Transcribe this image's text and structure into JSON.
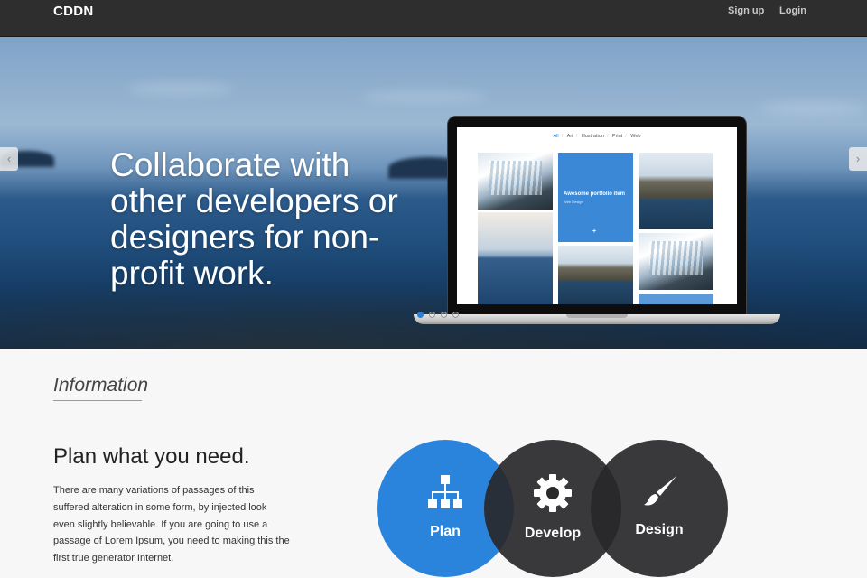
{
  "navbar": {
    "brand": "CDDN",
    "links": {
      "signup": "Sign up",
      "login": "Login"
    }
  },
  "hero": {
    "headline": "Collaborate with other developers or designers for non-profit work.",
    "arrows": {
      "prev": "‹",
      "next": "›"
    },
    "slides": {
      "count": 4,
      "active_index": 0
    }
  },
  "portfolio_mock": {
    "filters": [
      "All",
      "Art",
      "Illustration",
      "Print",
      "Web"
    ],
    "active_filter": "All",
    "featured_title": "Awesome portfolio item",
    "featured_subtitle": "Web Design",
    "featured_plus": "+"
  },
  "information": {
    "heading": "Information",
    "title": "Plan what you need.",
    "body": "There are many variations of passages of this suffered alteration in some form, by injected look even slightly believable. If you are going to use a passage of Lorem Ipsum, you need to making this the first true generator Internet."
  },
  "circles": {
    "plan": "Plan",
    "develop": "Develop",
    "design": "Design"
  },
  "colors": {
    "navbar_bg": "#2e2e2e",
    "accent": "#2a84dc",
    "circle_dark": "#28282a",
    "page_bg": "#f7f7f7"
  },
  "icons": {
    "plan": "sitemap-icon",
    "develop": "gear-icon",
    "design": "paintbrush-icon",
    "prev": "chevron-left-icon",
    "next": "chevron-right-icon"
  }
}
